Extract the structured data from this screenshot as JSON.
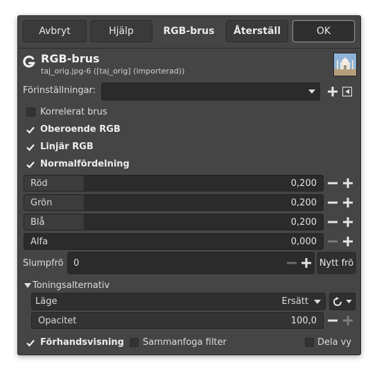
{
  "buttons": {
    "cancel": "Avbryt",
    "help": "Hjälp",
    "title_tab": "RGB-brus",
    "reset": "Återställ",
    "ok": "OK"
  },
  "header": {
    "title": "RGB-brus",
    "subtitle": "taj_orig.jpg-6 ([taj_orig] (importerad))"
  },
  "presets": {
    "label": "Förinställningar:",
    "value": ""
  },
  "checkboxes": {
    "correlated": {
      "label": "Korrelerat brus",
      "checked": false
    },
    "independent": {
      "label": "Oberoende RGB",
      "checked": true
    },
    "linear": {
      "label": "Linjär RGB",
      "checked": true
    },
    "gaussian": {
      "label": "Normalfördelning",
      "checked": true
    }
  },
  "sliders": [
    {
      "name": "Röd",
      "value": "0,200",
      "fraction": 0.2
    },
    {
      "name": "Grön",
      "value": "0,200",
      "fraction": 0.2
    },
    {
      "name": "Blå",
      "value": "0,200",
      "fraction": 0.2
    },
    {
      "name": "Alfa",
      "value": "0,000",
      "fraction": 0.0
    }
  ],
  "seed": {
    "label": "Slumpfrö",
    "value": "0",
    "new_seed_button": "Nytt frö"
  },
  "blending": {
    "section_label": "Toningsalternativ",
    "mode_label": "Läge",
    "mode_value": "Ersätt",
    "opacity_label": "Opacitet",
    "opacity_value": "100,0",
    "opacity_fraction": 1.0
  },
  "footer": {
    "preview": {
      "label": "Förhandsvisning",
      "checked": true
    },
    "merge": {
      "label": "Sammanfoga filter",
      "checked": false
    },
    "split": {
      "label": "Dela vy",
      "checked": false
    }
  },
  "colors": {
    "background": "#454545",
    "field": "#2b2b2b",
    "text": "#dcdcdc"
  }
}
